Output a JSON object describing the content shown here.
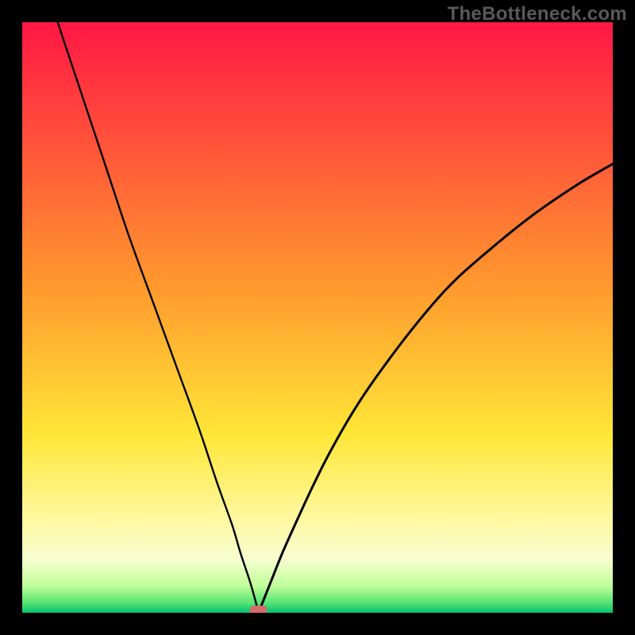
{
  "watermark": "TheBottleneck.com",
  "chart_data": {
    "type": "line",
    "title": "",
    "xlabel": "",
    "ylabel": "",
    "xlim": [
      0,
      100
    ],
    "ylim": [
      0,
      100
    ],
    "grid": false,
    "legend": false,
    "annotations": [
      {
        "name": "minimum-marker",
        "x": 40,
        "y": 0,
        "shape": "rounded-rect",
        "color": "#d46c6c"
      }
    ],
    "background_gradient": {
      "type": "vertical",
      "stops": [
        {
          "pos": 0.0,
          "color": "#ff1744"
        },
        {
          "pos": 0.45,
          "color": "#ff9a2e"
        },
        {
          "pos": 0.7,
          "color": "#ffe738"
        },
        {
          "pos": 0.84,
          "color": "#fff8a0"
        },
        {
          "pos": 0.91,
          "color": "#f6ffd0"
        },
        {
          "pos": 0.955,
          "color": "#c0ff9a"
        },
        {
          "pos": 0.985,
          "color": "#4fe070"
        },
        {
          "pos": 1.0,
          "color": "#00c074"
        }
      ]
    },
    "series": [
      {
        "name": "left-branch",
        "x": [
          6,
          10,
          14,
          18,
          22,
          26,
          30,
          33,
          35.5,
          37,
          38.5,
          39.5,
          40
        ],
        "y": [
          100,
          88,
          76,
          64,
          53,
          42,
          31,
          22,
          15,
          10,
          5.5,
          2,
          0
        ]
      },
      {
        "name": "right-branch",
        "x": [
          40,
          42,
          44,
          46,
          49,
          52,
          56,
          60,
          66,
          72,
          78,
          86,
          94,
          100
        ],
        "y": [
          0,
          5,
          10,
          14.5,
          21,
          27,
          34,
          40,
          48,
          55,
          60.5,
          67,
          72.5,
          76
        ]
      }
    ]
  }
}
